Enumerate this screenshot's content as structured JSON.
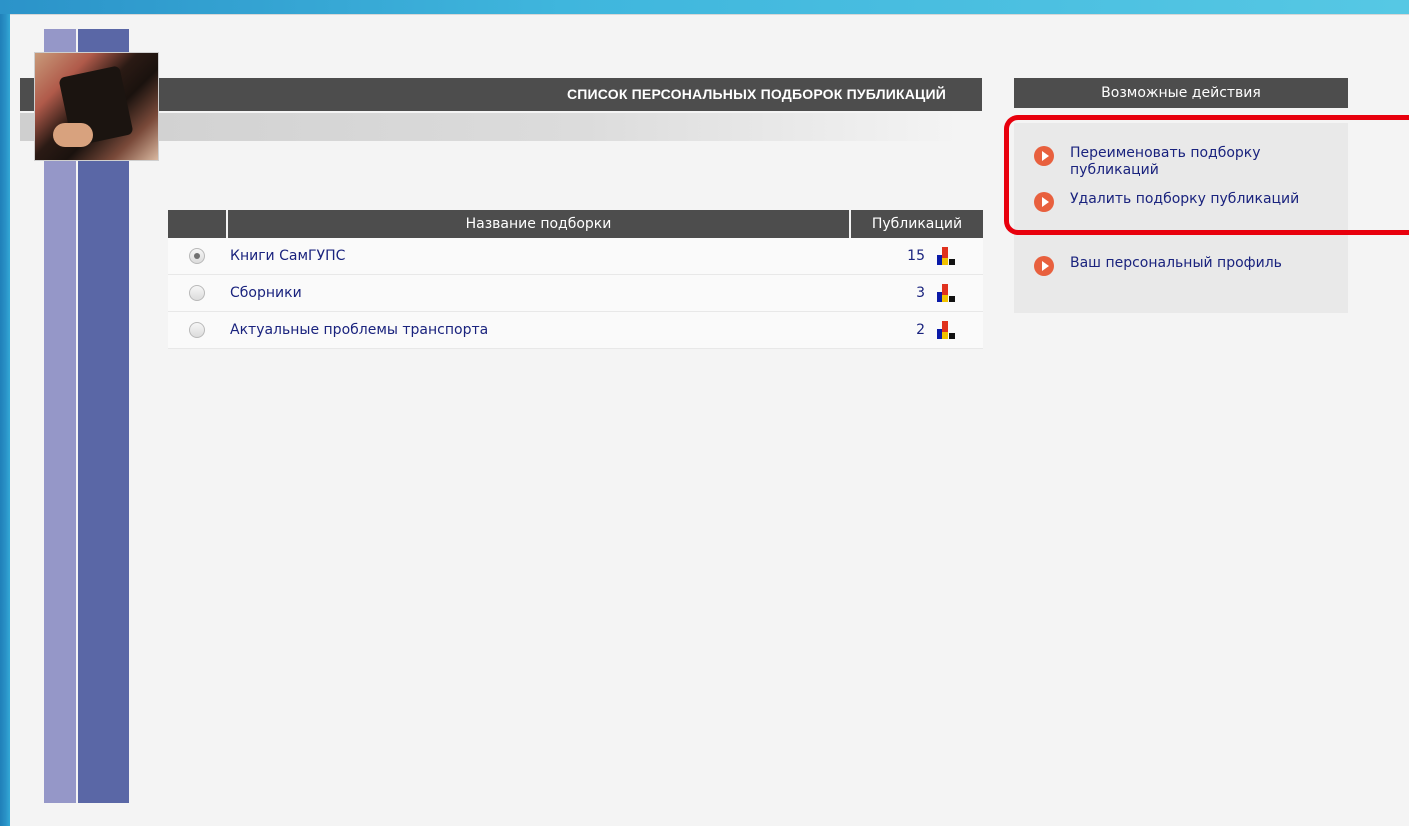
{
  "page": {
    "title": "СПИСОК ПЕРСОНАЛЬНЫХ ПОДБОРОК ПУБЛИКАЦИЙ"
  },
  "table": {
    "headers": {
      "name": "Название подборки",
      "count": "Публикаций"
    },
    "rows": [
      {
        "name": "Книги СамГУПС",
        "count": "15",
        "selected": true
      },
      {
        "name": "Сборники",
        "count": "3",
        "selected": false
      },
      {
        "name": "Актуальные проблемы транспорта",
        "count": "2",
        "selected": false
      }
    ]
  },
  "actions": {
    "title": "Возможные действия",
    "items": [
      {
        "label": "Переименовать подборку публикаций"
      },
      {
        "label": "Удалить подборку публикаций"
      },
      {
        "label": "Ваш персональный профиль"
      }
    ]
  },
  "colors": {
    "header_bg": "#4d4d4d",
    "link": "#1a237e",
    "action_icon": "#e8603e",
    "highlight": "#e8000d"
  }
}
